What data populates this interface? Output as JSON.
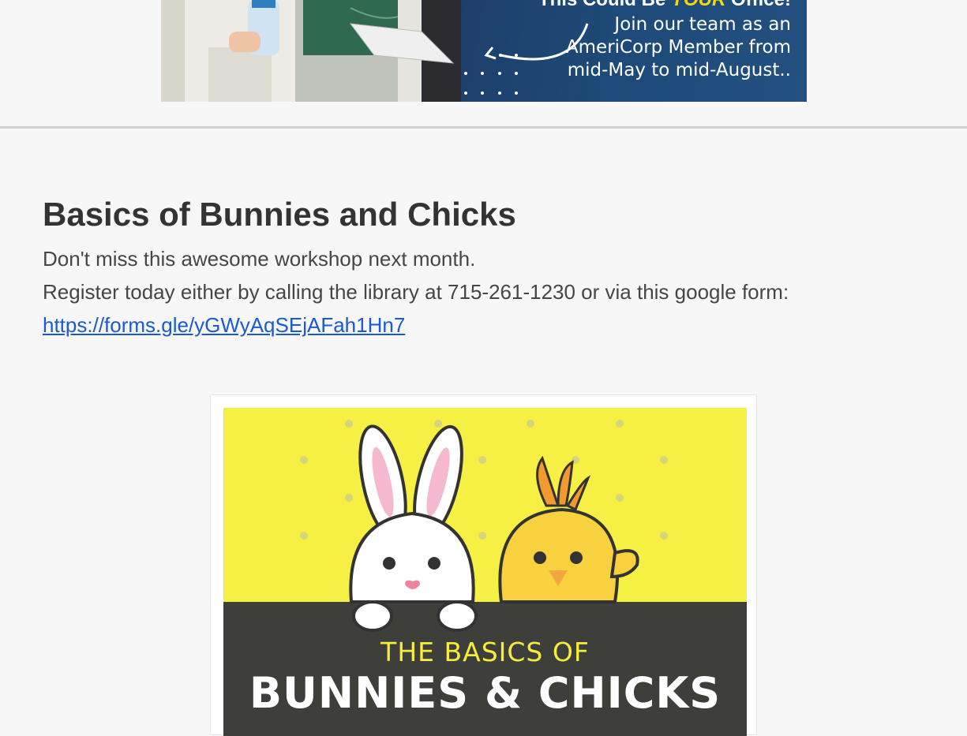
{
  "banner": {
    "headline_prefix": "This Could Be ",
    "headline_emph": "YOUR",
    "headline_suffix": " Office!",
    "line1": "Join our team as an",
    "line2": "AmeriCorp Member from",
    "line3": "mid-May to mid-August.."
  },
  "article": {
    "title": "Basics of Bunnies and Chicks",
    "line1": "Don't miss this awesome workshop next month.",
    "line2_prefix": "Register today either by calling the library at 715-261-1230 or via this google form: ",
    "link_text": "https://forms.gle/yGWyAqSEjAFah1Hn7",
    "link_href": "https://forms.gle/yGWyAqSEjAFah1Hn7"
  },
  "poster": {
    "pre_title": "THE BASICS OF",
    "main_title": "BUNNIES & CHICKS"
  },
  "colors": {
    "background": "#f7f7f7",
    "banner_panel": "#1f4f7a",
    "accent_yellow": "#f6f045",
    "link": "#1a59d6"
  }
}
